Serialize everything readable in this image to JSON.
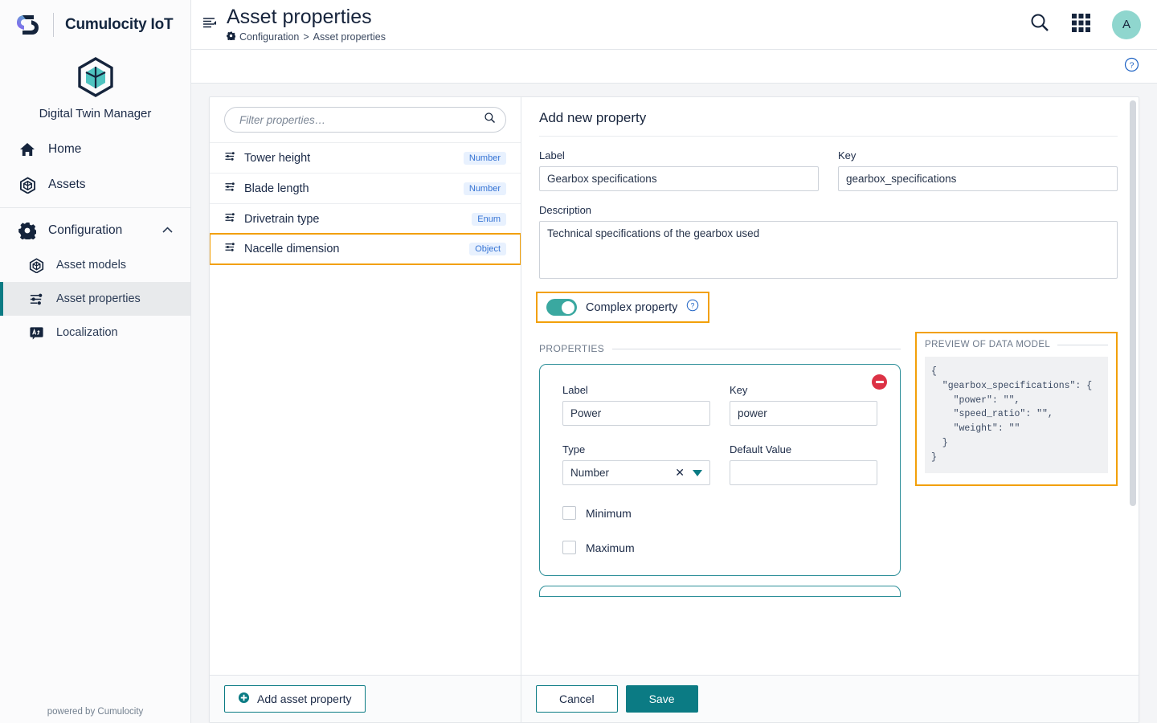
{
  "sidebar": {
    "brand": "Cumulocity IoT",
    "product": "Digital Twin Manager",
    "items": [
      {
        "label": "Home",
        "icon": "home-icon"
      },
      {
        "label": "Assets",
        "icon": "cube-icon"
      }
    ],
    "group": {
      "label": "Configuration",
      "icon": "gear-icon",
      "chevron": "chevron-up-icon"
    },
    "sub_items": [
      {
        "label": "Asset models",
        "icon": "cube-icon",
        "active": false
      },
      {
        "label": "Asset properties",
        "icon": "sliders-icon",
        "active": true
      },
      {
        "label": "Localization",
        "icon": "translate-icon",
        "active": false
      }
    ],
    "footer": "powered by Cumulocity"
  },
  "topbar": {
    "title": "Asset properties",
    "breadcrumb_root": "Configuration",
    "breadcrumb_sep": ">",
    "breadcrumb_current": "Asset properties",
    "avatar_initial": "A"
  },
  "list_panel": {
    "filter_placeholder": "Filter properties…",
    "filter_value": "",
    "rows": [
      {
        "name": "Tower height",
        "type": "Number",
        "highlighted": false
      },
      {
        "name": "Blade length",
        "type": "Number",
        "highlighted": false
      },
      {
        "name": "Drivetrain type",
        "type": "Enum",
        "highlighted": false
      },
      {
        "name": "Nacelle dimension",
        "type": "Object",
        "highlighted": true
      }
    ],
    "add_button": "Add asset property"
  },
  "form": {
    "title": "Add new property",
    "label_field": {
      "label": "Label",
      "value": "Gearbox specifications"
    },
    "key_field": {
      "label": "Key",
      "value": "gearbox_specifications"
    },
    "description_field": {
      "label": "Description",
      "value": "Technical specifications of the gearbox used"
    },
    "complex_toggle": {
      "label": "Complex property",
      "state": "on",
      "help_icon": "question-circle-icon"
    },
    "properties_legend": "PROPERTIES",
    "sub_property": {
      "label_field": {
        "label": "Label",
        "value": "Power"
      },
      "key_field": {
        "label": "Key",
        "value": "power"
      },
      "type_field": {
        "label": "Type",
        "value": "Number"
      },
      "default_field": {
        "label": "Default Value",
        "value": ""
      },
      "minimum": {
        "label": "Minimum",
        "checked": false
      },
      "maximum": {
        "label": "Maximum",
        "checked": false
      }
    },
    "cancel_button": "Cancel",
    "save_button": "Save"
  },
  "preview": {
    "title": "PREVIEW OF DATA MODEL",
    "code": "{\n  \"gearbox_specifications\": {\n    \"power\": \"\",\n    \"speed_ratio\": \"\",\n    \"weight\": \"\"\n  }\n}"
  },
  "colors": {
    "accent_teal": "#0b7b84",
    "highlight_orange": "#f2a00a",
    "badge_blue": "#3573d4",
    "danger_red": "#dc3245",
    "toggle_on": "#3aa8a0"
  }
}
